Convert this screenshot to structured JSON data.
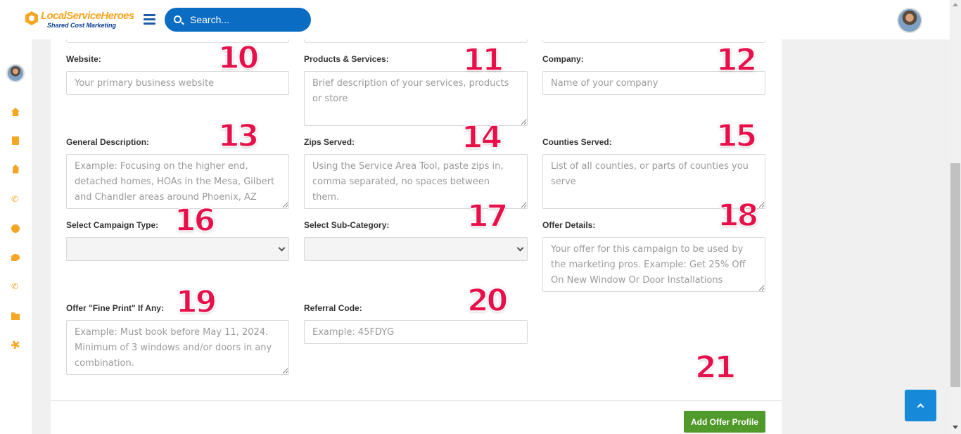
{
  "header": {
    "logo_main": "LocalServiceHeroes",
    "logo_sub": "Shared Cost Marketing",
    "search_placeholder": "Search..."
  },
  "sidebar": {
    "icons": [
      "home-icon",
      "document-icon",
      "tag-icon",
      "phone-icon",
      "globe-icon",
      "chat-icon",
      "phone-icon",
      "folder-icon",
      "gear-icon"
    ]
  },
  "form": {
    "website": {
      "label": "Website:",
      "placeholder": "Your primary business website"
    },
    "products": {
      "label": "Products & Services:",
      "placeholder": "Brief description of your services, products or store"
    },
    "company": {
      "label": "Company:",
      "placeholder": "Name of your company"
    },
    "general": {
      "label": "General Description:",
      "placeholder": "Example: Focusing on the higher end, detached homes, HOAs in the Mesa, Gilbert and Chandler areas around Phoenix, AZ"
    },
    "zips": {
      "label": "Zips Served:",
      "placeholder": "Using the Service Area Tool, paste zips in, comma separated, no spaces between them."
    },
    "counties": {
      "label": "Counties Served:",
      "placeholder": "List of all counties, or parts of counties you serve"
    },
    "campaign_type": {
      "label": "Select Campaign Type:",
      "value": ""
    },
    "sub_category": {
      "label": "Select Sub-Category:",
      "value": ""
    },
    "offer_details": {
      "label": "Offer Details:",
      "placeholder": "Your offer for this campaign to be used by the marketing pros. Example: Get 25% Off On New Window Or Door Installations"
    },
    "fine_print": {
      "label": "Offer \"Fine Print\" If Any:",
      "placeholder": "Example: Must book before May 11, 2024. Minimum of 3 windows and/or doors in any combination."
    },
    "referral": {
      "label": "Referral Code:",
      "placeholder": "Example: 45FDYG"
    },
    "submit_label": "Add Offer Profile"
  },
  "annotations": {
    "n10": "10",
    "n11": "11",
    "n12": "12",
    "n13": "13",
    "n14": "14",
    "n15": "15",
    "n16": "16",
    "n17": "17",
    "n18": "18",
    "n19": "19",
    "n20": "20",
    "n21": "21"
  },
  "colors": {
    "accent_blue": "#0a6cc2",
    "accent_orange": "#f5a623",
    "button_green": "#4f9a2a",
    "annotation_red": "#e8104a"
  }
}
